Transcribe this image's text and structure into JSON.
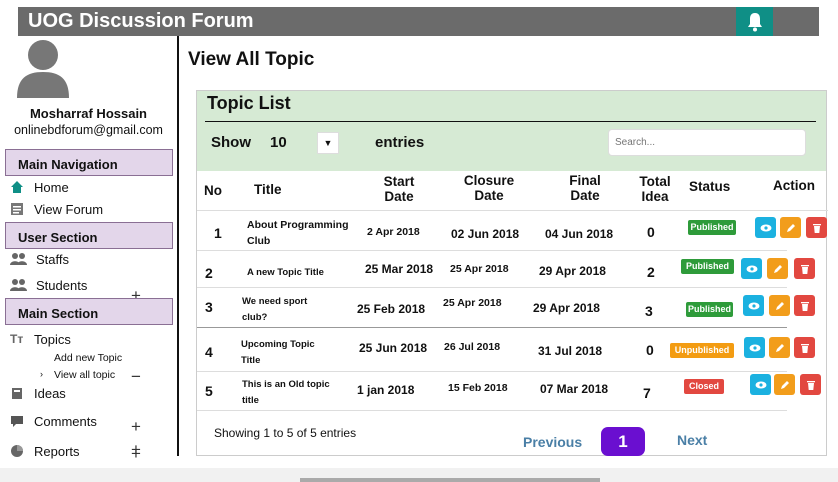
{
  "app": {
    "title": "UOG Discussion Forum"
  },
  "user": {
    "name": "Mosharraf Hossain",
    "email": "onlinebdforum@gmail.com"
  },
  "sidebar": {
    "main_nav_header": "Main Navigation",
    "home": "Home",
    "view_forum": "View Forum",
    "user_section_header": "User Section",
    "staffs": "Staffs",
    "students": "Students",
    "main_section_header": "Main Section",
    "topics": "Topics",
    "add_new_topic": "Add new Topic",
    "view_all_topic": "View all topic",
    "ideas": "Ideas",
    "comments": "Comments",
    "reports": "Reports"
  },
  "page": {
    "title": "View All Topic"
  },
  "topic_list": {
    "title": "Topic List",
    "show_label": "Show",
    "entries_value": "10",
    "entries_label": "entries",
    "search_placeholder": "Search...",
    "columns": {
      "no": "No",
      "title": "Title",
      "start_date": "Start Date",
      "closure_date": "Closure Date",
      "final_date": "Final Date",
      "total_idea": "Total Idea",
      "status": "Status",
      "action": "Action"
    },
    "rows": [
      {
        "no": "1",
        "title": "About Programming Club",
        "start": "2 Apr 2018",
        "closure": "02 Jun 2018",
        "final": "04 Jun 2018",
        "ideas": "0",
        "status": "Published"
      },
      {
        "no": "2",
        "title": "A new Topic Title",
        "start": "25 Mar 2018",
        "closure": "25 Apr 2018",
        "final": "29 Apr 2018",
        "ideas": "2",
        "status": "Published"
      },
      {
        "no": "3",
        "title": "We need sport club?",
        "start": "25 Feb 2018",
        "closure": "25 Apr 2018",
        "final": "29 Apr 2018",
        "ideas": "3",
        "status": "Published"
      },
      {
        "no": "4",
        "title": "Upcoming Topic Title",
        "start": "25 Jun 2018",
        "closure": "26 Jul 2018",
        "final": "31 Jul 2018",
        "ideas": "0",
        "status": "Unpublished"
      },
      {
        "no": "5",
        "title": "This is an Old topic title",
        "start": "1 jan 2018",
        "closure": "15 Feb 2018",
        "final": "07 Mar 2018",
        "ideas": "7",
        "status": "Closed"
      }
    ],
    "info": "Showing 1 to 5 of 5 entries",
    "pagination": {
      "previous": "Previous",
      "current": "1",
      "next": "Next"
    }
  },
  "colors": {
    "published": "#2e9b3a",
    "unpublished": "#f39c12",
    "closed": "#e24840",
    "accent": "#6a0fd0"
  }
}
